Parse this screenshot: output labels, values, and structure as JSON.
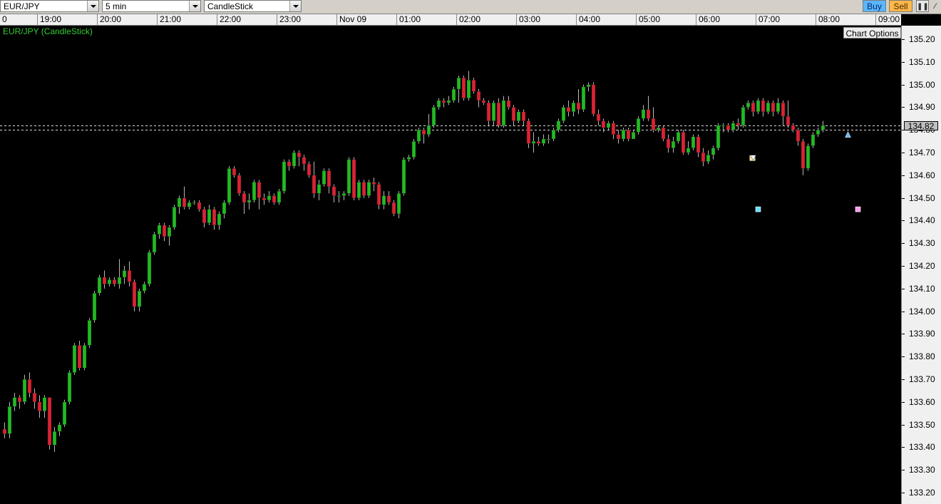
{
  "toolbar": {
    "symbol": "EUR/JPY",
    "interval": "5 min",
    "chart_type": "CandleStick",
    "buy_label": "Buy",
    "sell_label": "Sell"
  },
  "chart": {
    "title": "EUR/JPY (CandleStick)",
    "options_label": "Chart Options",
    "current_price": "134.82"
  },
  "colors": {
    "bull": "#22bb22",
    "bear": "#dd2233",
    "wick": "#b8b8b8",
    "background": "#000000",
    "marker_cyan": "#66ddff",
    "marker_pink": "#ff99ee"
  },
  "chart_data": {
    "type": "candlestick",
    "symbol": "EUR/JPY",
    "interval": "5 min",
    "ylim": [
      133.15,
      135.26
    ],
    "grid": false,
    "y_ticks": [
      "135.20",
      "135.10",
      "135.00",
      "134.90",
      "134.80",
      "134.70",
      "134.60",
      "134.50",
      "134.40",
      "134.30",
      "134.20",
      "134.10",
      "134.00",
      "133.90",
      "133.80",
      "133.70",
      "133.60",
      "133.50",
      "133.40",
      "133.30",
      "133.20"
    ],
    "x_ticks": [
      {
        "label": "0",
        "candle": 0
      },
      {
        "label": "19:00",
        "candle": 7
      },
      {
        "label": "20:00",
        "candle": 19
      },
      {
        "label": "21:00",
        "candle": 31
      },
      {
        "label": "22:00",
        "candle": 43
      },
      {
        "label": "23:00",
        "candle": 55
      },
      {
        "label": "Nov 09",
        "candle": 67
      },
      {
        "label": "01:00",
        "candle": 79
      },
      {
        "label": "02:00",
        "candle": 91
      },
      {
        "label": "03:00",
        "candle": 103
      },
      {
        "label": "04:00",
        "candle": 115
      },
      {
        "label": "05:00",
        "candle": 127
      },
      {
        "label": "06:00",
        "candle": 139
      },
      {
        "label": "07:00",
        "candle": 151
      },
      {
        "label": "08:00",
        "candle": 163
      },
      {
        "label": "09:00",
        "candle": 175
      }
    ],
    "candles": [
      [
        133.48,
        133.46,
        133.51,
        133.44
      ],
      [
        133.46,
        133.58,
        133.6,
        133.44
      ],
      [
        133.58,
        133.62,
        133.64,
        133.56
      ],
      [
        133.62,
        133.6,
        133.63,
        133.57
      ],
      [
        133.6,
        133.7,
        133.72,
        133.59
      ],
      [
        133.7,
        133.64,
        133.73,
        133.62
      ],
      [
        133.64,
        133.6,
        133.66,
        133.57
      ],
      [
        133.6,
        133.56,
        133.63,
        133.53
      ],
      [
        133.56,
        133.62,
        133.63,
        133.53
      ],
      [
        133.62,
        133.41,
        133.62,
        133.39
      ],
      [
        133.41,
        133.47,
        133.49,
        133.38
      ],
      [
        133.47,
        133.5,
        133.51,
        133.45
      ],
      [
        133.5,
        133.6,
        133.61,
        133.49
      ],
      [
        133.6,
        133.73,
        133.74,
        133.59
      ],
      [
        133.73,
        133.85,
        133.86,
        133.72
      ],
      [
        133.85,
        133.75,
        133.87,
        133.74
      ],
      [
        133.75,
        133.85,
        133.86,
        133.74
      ],
      [
        133.85,
        133.96,
        133.97,
        133.84
      ],
      [
        133.96,
        134.08,
        134.09,
        133.95
      ],
      [
        134.08,
        134.15,
        134.16,
        134.07
      ],
      [
        134.15,
        134.12,
        134.18,
        134.1
      ],
      [
        134.12,
        134.14,
        134.15,
        134.11
      ],
      [
        134.14,
        134.12,
        134.15,
        134.11
      ],
      [
        134.12,
        134.15,
        134.23,
        134.1
      ],
      [
        134.15,
        134.18,
        134.2,
        134.12
      ],
      [
        134.18,
        134.13,
        134.22,
        134.11
      ],
      [
        134.13,
        134.02,
        134.14,
        134.0
      ],
      [
        134.02,
        134.09,
        134.1,
        134.0
      ],
      [
        134.09,
        134.12,
        134.13,
        134.08
      ],
      [
        134.12,
        134.26,
        134.27,
        134.11
      ],
      [
        134.26,
        134.34,
        134.35,
        134.25
      ],
      [
        134.34,
        134.38,
        134.39,
        134.32
      ],
      [
        134.38,
        134.33,
        134.39,
        134.31
      ],
      [
        134.33,
        134.37,
        134.38,
        134.29
      ],
      [
        134.37,
        134.46,
        134.47,
        134.36
      ],
      [
        134.46,
        134.5,
        134.51,
        134.43
      ],
      [
        134.5,
        134.46,
        134.55,
        134.45
      ],
      [
        134.46,
        134.48,
        134.49,
        134.45
      ],
      [
        134.48,
        134.48,
        134.49,
        134.47
      ],
      [
        134.48,
        134.45,
        134.49,
        134.44
      ],
      [
        134.45,
        134.39,
        134.46,
        134.37
      ],
      [
        134.39,
        134.45,
        134.47,
        134.38
      ],
      [
        134.45,
        134.38,
        134.46,
        134.36
      ],
      [
        134.38,
        134.43,
        134.44,
        134.36
      ],
      [
        134.43,
        134.48,
        134.49,
        134.41
      ],
      [
        134.48,
        134.63,
        134.64,
        134.47
      ],
      [
        134.63,
        134.6,
        134.64,
        134.59
      ],
      [
        134.6,
        134.52,
        134.61,
        134.51
      ],
      [
        134.52,
        134.48,
        134.53,
        134.43
      ],
      [
        134.48,
        134.49,
        134.52,
        134.45
      ],
      [
        134.49,
        134.57,
        134.58,
        134.48
      ],
      [
        134.57,
        134.5,
        134.58,
        134.45
      ],
      [
        134.5,
        134.49,
        134.52,
        134.47
      ],
      [
        134.49,
        134.51,
        134.53,
        134.48
      ],
      [
        134.51,
        134.48,
        134.52,
        134.47
      ],
      [
        134.48,
        134.53,
        134.54,
        134.47
      ],
      [
        134.53,
        134.66,
        134.67,
        134.52
      ],
      [
        134.66,
        134.64,
        134.67,
        134.62
      ],
      [
        134.64,
        134.7,
        134.71,
        134.63
      ],
      [
        134.7,
        134.68,
        134.71,
        134.64
      ],
      [
        134.68,
        134.65,
        134.69,
        134.62
      ],
      [
        134.65,
        134.6,
        134.66,
        134.59
      ],
      [
        134.6,
        134.52,
        134.66,
        134.5
      ],
      [
        134.52,
        134.56,
        134.58,
        134.49
      ],
      [
        134.56,
        134.62,
        134.63,
        134.55
      ],
      [
        134.62,
        134.55,
        134.63,
        134.52
      ],
      [
        134.55,
        134.51,
        134.56,
        134.48
      ],
      [
        134.51,
        134.51,
        134.53,
        134.48
      ],
      [
        134.51,
        134.52,
        134.53,
        134.49
      ],
      [
        134.52,
        134.67,
        134.68,
        134.51
      ],
      [
        134.67,
        134.5,
        134.68,
        134.49
      ],
      [
        134.5,
        134.57,
        134.58,
        134.49
      ],
      [
        134.57,
        134.51,
        134.58,
        134.5
      ],
      [
        134.51,
        134.57,
        134.58,
        134.5
      ],
      [
        134.57,
        134.56,
        134.59,
        134.53
      ],
      [
        134.56,
        134.47,
        134.57,
        134.45
      ],
      [
        134.47,
        134.51,
        134.53,
        134.45
      ],
      [
        134.51,
        134.48,
        134.53,
        134.47
      ],
      [
        134.48,
        134.43,
        134.49,
        134.42
      ],
      [
        134.43,
        134.52,
        134.53,
        134.41
      ],
      [
        134.52,
        134.67,
        134.68,
        134.51
      ],
      [
        134.67,
        134.68,
        134.69,
        134.66
      ],
      [
        134.68,
        134.75,
        134.76,
        134.67
      ],
      [
        134.75,
        134.8,
        134.81,
        134.74
      ],
      [
        134.8,
        134.78,
        134.81,
        134.74
      ],
      [
        134.78,
        134.82,
        134.87,
        134.77
      ],
      [
        134.82,
        134.9,
        134.91,
        134.81
      ],
      [
        134.9,
        134.93,
        134.94,
        134.89
      ],
      [
        134.93,
        134.92,
        134.94,
        134.9
      ],
      [
        134.92,
        134.93,
        134.95,
        134.91
      ],
      [
        134.93,
        134.98,
        134.99,
        134.92
      ],
      [
        134.98,
        135.03,
        135.04,
        134.92
      ],
      [
        135.03,
        134.94,
        135.04,
        134.93
      ],
      [
        134.94,
        135.02,
        135.06,
        134.93
      ],
      [
        135.02,
        134.97,
        135.03,
        134.96
      ],
      [
        134.97,
        134.93,
        134.98,
        134.9
      ],
      [
        134.93,
        134.92,
        134.94,
        134.91
      ],
      [
        134.92,
        134.84,
        134.93,
        134.82
      ],
      [
        134.84,
        134.92,
        134.93,
        134.82
      ],
      [
        134.92,
        134.82,
        134.94,
        134.81
      ],
      [
        134.82,
        134.93,
        134.95,
        134.81
      ],
      [
        134.93,
        134.9,
        134.95,
        134.89
      ],
      [
        134.9,
        134.84,
        134.91,
        134.82
      ],
      [
        134.84,
        134.88,
        134.89,
        134.83
      ],
      [
        134.88,
        134.84,
        134.89,
        134.82
      ],
      [
        134.84,
        134.74,
        134.85,
        134.72
      ],
      [
        134.74,
        134.75,
        134.79,
        134.7
      ],
      [
        134.75,
        134.74,
        134.77,
        134.73
      ],
      [
        134.74,
        134.76,
        134.78,
        134.73
      ],
      [
        134.76,
        134.76,
        134.78,
        134.74
      ],
      [
        134.76,
        134.8,
        134.81,
        134.75
      ],
      [
        134.8,
        134.84,
        134.85,
        134.79
      ],
      [
        134.84,
        134.9,
        134.91,
        134.83
      ],
      [
        134.9,
        134.88,
        134.93,
        134.86
      ],
      [
        134.88,
        134.92,
        134.93,
        134.86
      ],
      [
        134.92,
        134.89,
        134.98,
        134.87
      ],
      [
        134.89,
        134.99,
        135.0,
        134.88
      ],
      [
        134.99,
        135.0,
        135.01,
        134.97
      ],
      [
        135.0,
        134.87,
        135.01,
        134.86
      ],
      [
        134.87,
        134.84,
        134.89,
        134.82
      ],
      [
        134.84,
        134.81,
        134.85,
        134.79
      ],
      [
        134.81,
        134.83,
        134.84,
        134.8
      ],
      [
        134.83,
        134.78,
        134.84,
        134.76
      ],
      [
        134.78,
        134.76,
        134.8,
        134.74
      ],
      [
        134.76,
        134.8,
        134.81,
        134.75
      ],
      [
        134.8,
        134.76,
        134.81,
        134.75
      ],
      [
        134.76,
        134.79,
        134.8,
        134.77
      ],
      [
        134.79,
        134.85,
        134.86,
        134.78
      ],
      [
        134.85,
        134.89,
        134.91,
        134.84
      ],
      [
        134.89,
        134.85,
        134.95,
        134.84
      ],
      [
        134.85,
        134.8,
        134.9,
        134.79
      ],
      [
        134.8,
        134.81,
        134.82,
        134.79
      ],
      [
        134.81,
        134.76,
        134.82,
        134.75
      ],
      [
        134.76,
        134.72,
        134.78,
        134.7
      ],
      [
        134.72,
        134.75,
        134.77,
        134.7
      ],
      [
        134.75,
        134.79,
        134.8,
        134.74
      ],
      [
        134.79,
        134.7,
        134.8,
        134.69
      ],
      [
        134.7,
        134.72,
        134.75,
        134.69
      ],
      [
        134.72,
        134.77,
        134.78,
        134.71
      ],
      [
        134.77,
        134.7,
        134.78,
        134.68
      ],
      [
        134.7,
        134.66,
        134.72,
        134.64
      ],
      [
        134.66,
        134.69,
        134.71,
        134.65
      ],
      [
        134.69,
        134.72,
        134.73,
        134.67
      ],
      [
        134.72,
        134.82,
        134.83,
        134.71
      ],
      [
        134.82,
        134.82,
        134.83,
        134.79
      ],
      [
        134.82,
        134.8,
        134.83,
        134.79
      ],
      [
        134.8,
        134.83,
        134.84,
        134.79
      ],
      [
        134.83,
        134.82,
        134.85,
        134.8
      ],
      [
        134.82,
        134.9,
        134.91,
        134.81
      ],
      [
        134.9,
        134.92,
        134.93,
        134.89
      ],
      [
        134.92,
        134.88,
        134.93,
        134.86
      ],
      [
        134.88,
        134.93,
        134.94,
        134.87
      ],
      [
        134.93,
        134.88,
        134.94,
        134.86
      ],
      [
        134.88,
        134.92,
        134.93,
        134.87
      ],
      [
        134.92,
        134.88,
        134.93,
        134.86
      ],
      [
        134.88,
        134.92,
        134.94,
        134.87
      ],
      [
        134.92,
        134.86,
        134.93,
        134.82
      ],
      [
        134.86,
        134.82,
        134.93,
        134.81
      ],
      [
        134.82,
        134.8,
        134.83,
        134.79
      ],
      [
        134.8,
        134.75,
        134.81,
        134.73
      ],
      [
        134.75,
        134.63,
        134.76,
        134.6
      ],
      [
        134.63,
        134.73,
        134.74,
        134.62
      ],
      [
        134.73,
        134.78,
        134.79,
        134.72
      ],
      [
        134.78,
        134.8,
        134.81,
        134.77
      ],
      [
        134.8,
        134.82,
        134.84,
        134.79
      ]
    ],
    "price_lines": [
      134.82,
      134.8
    ],
    "markers": [
      {
        "type": "sell-arrow",
        "candle": 150,
        "price": 134.67
      },
      {
        "type": "buy-arrow",
        "candle": 169,
        "price": 134.78
      },
      {
        "type": "square",
        "candle": 151,
        "price": 134.45,
        "color": "#66ddff"
      },
      {
        "type": "square",
        "candle": 171,
        "price": 134.45,
        "color": "#ff99ee"
      }
    ]
  }
}
